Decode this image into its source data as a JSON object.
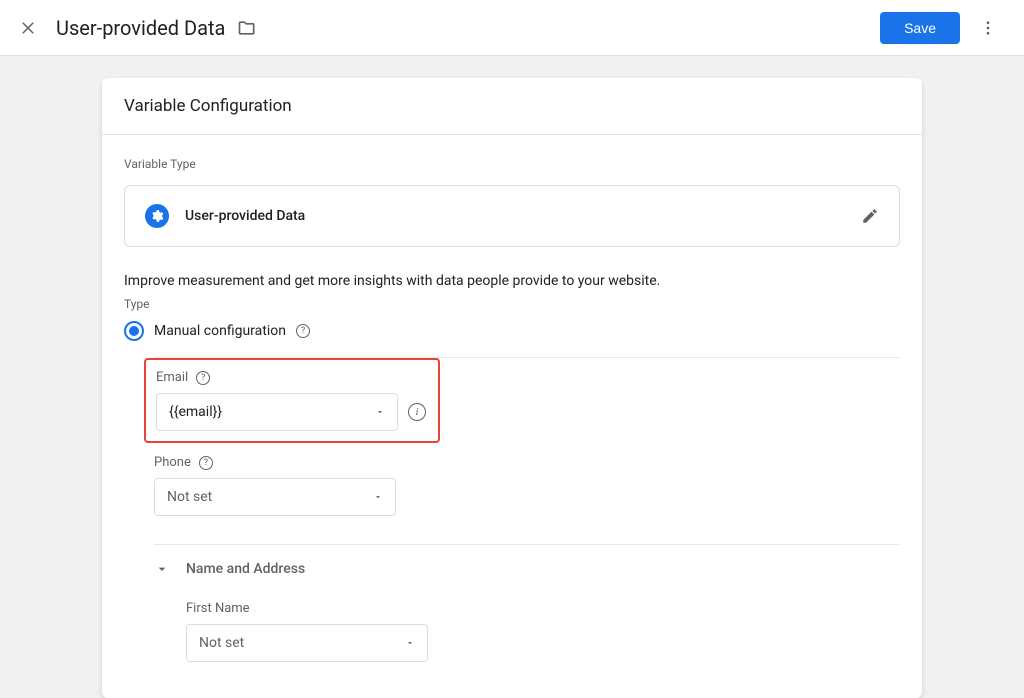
{
  "topbar": {
    "title": "User-provided Data",
    "save_label": "Save"
  },
  "card": {
    "header": "Variable Configuration",
    "variable_type_label": "Variable Type",
    "variable_type_name": "User-provided Data",
    "description": "Improve measurement and get more insights with data people provide to your website.",
    "type_label": "Type",
    "radio_label": "Manual configuration",
    "fields": {
      "email": {
        "label": "Email",
        "value": "{{email}}"
      },
      "phone": {
        "label": "Phone",
        "value": "Not set"
      },
      "name_address": {
        "label": "Name and Address",
        "first_name": {
          "label": "First Name",
          "value": "Not set"
        }
      }
    }
  }
}
